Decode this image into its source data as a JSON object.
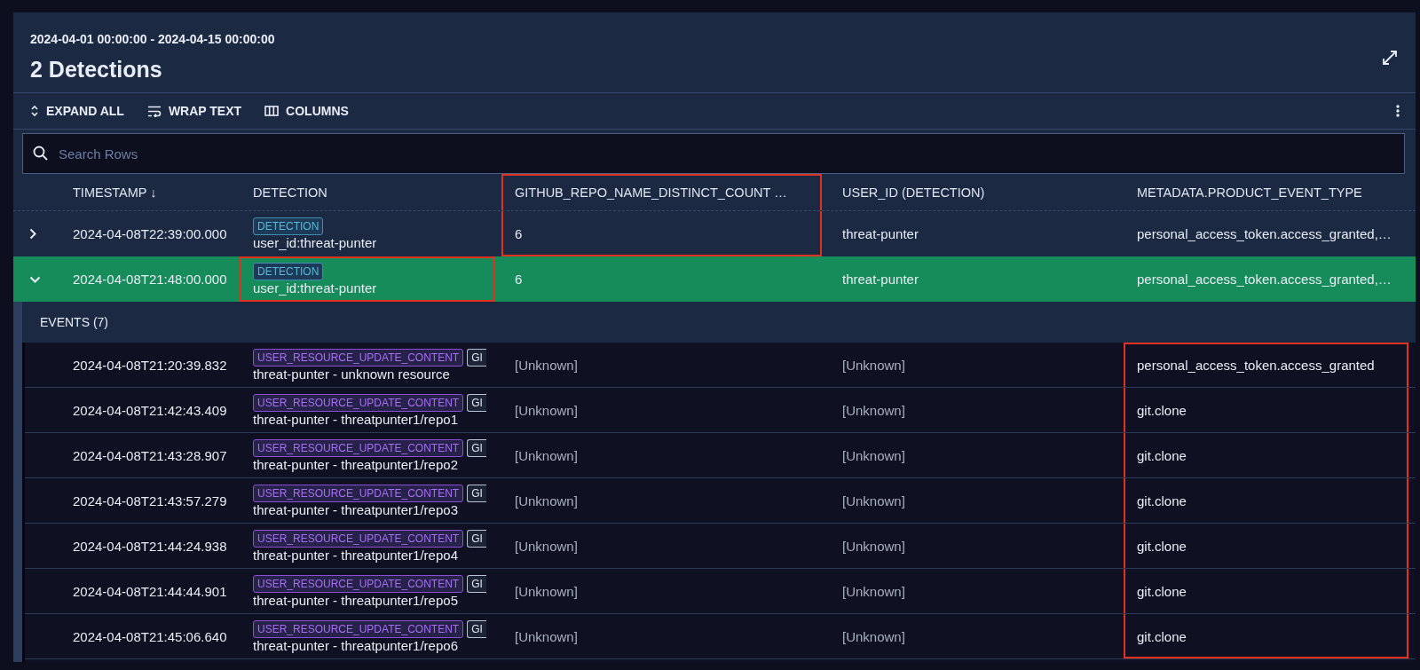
{
  "date_range": "2024-04-01 00:00:00 - 2024-04-15 00:00:00",
  "title": "2 Detections",
  "toolbar": [
    {
      "kind": "expand",
      "label": "EXPAND ALL"
    },
    {
      "kind": "wrap",
      "label": "WRAP TEXT"
    },
    {
      "kind": "columns",
      "label": "COLUMNS"
    }
  ],
  "search": {
    "placeholder": "Search Rows"
  },
  "columns": [
    {
      "label": "TIMESTAMP ↓",
      "marked": false
    },
    {
      "label": "DETECTION",
      "marked": false
    },
    {
      "label": "GITHUB_REPO_NAME_DISTINCT_COUNT …",
      "marked": true
    },
    {
      "label": "USER_ID (DETECTION)",
      "marked": false
    },
    {
      "label": "METADATA.PRODUCT_EVENT_TYPE",
      "marked": false
    }
  ],
  "detections": [
    {
      "expanded": false,
      "selected": false,
      "timestamp": "2024-04-08T22:39:00.000",
      "tag": "DETECTION",
      "detection": "user_id:threat-punter",
      "detection_marked": false,
      "count": "6",
      "count_marked": true,
      "user_id": "threat-punter",
      "event_type": "personal_access_token.access_granted,…"
    },
    {
      "expanded": true,
      "selected": true,
      "timestamp": "2024-04-08T21:48:00.000",
      "tag": "DETECTION",
      "detection": "user_id:threat-punter",
      "detection_marked": true,
      "count": "6",
      "count_marked": false,
      "user_id": "threat-punter",
      "event_type": "personal_access_token.access_granted,…",
      "events_label": "EVENTS (7)",
      "events": [
        {
          "timestamp": "2024-04-08T21:20:39.832",
          "tags": [
            "USER_RESOURCE_UPDATE_CONTENT",
            "GI"
          ],
          "detection": "threat-punter - unknown resource",
          "count": "[Unknown]",
          "user_id": "[Unknown]",
          "event_type": "personal_access_token.access_granted",
          "event_type_marked": true
        },
        {
          "timestamp": "2024-04-08T21:42:43.409",
          "tags": [
            "USER_RESOURCE_UPDATE_CONTENT",
            "GI"
          ],
          "detection": "threat-punter - threatpunter1/repo1",
          "count": "[Unknown]",
          "user_id": "[Unknown]",
          "event_type": "git.clone",
          "event_type_marked": true
        },
        {
          "timestamp": "2024-04-08T21:43:28.907",
          "tags": [
            "USER_RESOURCE_UPDATE_CONTENT",
            "GI"
          ],
          "detection": "threat-punter - threatpunter1/repo2",
          "count": "[Unknown]",
          "user_id": "[Unknown]",
          "event_type": "git.clone",
          "event_type_marked": true
        },
        {
          "timestamp": "2024-04-08T21:43:57.279",
          "tags": [
            "USER_RESOURCE_UPDATE_CONTENT",
            "GI"
          ],
          "detection": "threat-punter - threatpunter1/repo3",
          "count": "[Unknown]",
          "user_id": "[Unknown]",
          "event_type": "git.clone",
          "event_type_marked": true
        },
        {
          "timestamp": "2024-04-08T21:44:24.938",
          "tags": [
            "USER_RESOURCE_UPDATE_CONTENT",
            "GI"
          ],
          "detection": "threat-punter - threatpunter1/repo4",
          "count": "[Unknown]",
          "user_id": "[Unknown]",
          "event_type": "git.clone",
          "event_type_marked": true
        },
        {
          "timestamp": "2024-04-08T21:44:44.901",
          "tags": [
            "USER_RESOURCE_UPDATE_CONTENT",
            "GI"
          ],
          "detection": "threat-punter - threatpunter1/repo5",
          "count": "[Unknown]",
          "user_id": "[Unknown]",
          "event_type": "git.clone",
          "event_type_marked": true
        },
        {
          "timestamp": "2024-04-08T21:45:06.640",
          "tags": [
            "USER_RESOURCE_UPDATE_CONTENT",
            "GI"
          ],
          "detection": "threat-punter - threatpunter1/repo6",
          "count": "[Unknown]",
          "user_id": "[Unknown]",
          "event_type": "git.clone",
          "event_type_marked": true
        }
      ]
    }
  ]
}
